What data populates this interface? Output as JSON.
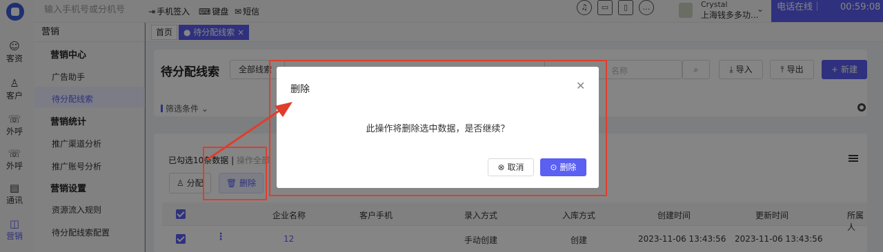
{
  "topbar": {
    "search_placeholder": "输入手机号或分机号",
    "actions": [
      "手机签入",
      "键盘",
      "短信"
    ],
    "user_name": "Crystal",
    "user_org": "上海钱多多功...",
    "phone_status": "电话在线｜",
    "timer": "00:59:08"
  },
  "rail": {
    "items": [
      "客资",
      "客户",
      "外呼",
      "外呼",
      "通讯",
      "营销"
    ]
  },
  "sidebar": {
    "title": "营销",
    "groups": [
      {
        "label": "营销中心",
        "items": [
          "广告助手",
          "待分配线索"
        ]
      },
      {
        "label": "营销统计",
        "items": [
          "推广渠道分析",
          "推广账号分析"
        ]
      },
      {
        "label": "营销设置",
        "items": [
          "资源流入规则",
          "待分配线索配置"
        ]
      }
    ]
  },
  "tabs": [
    "首页",
    "● 待分配线索 ×"
  ],
  "page": {
    "title": "待分配线索",
    "filter_select": "全部线索",
    "search_placeholder": "名称",
    "import_label": "导入",
    "export_label": "导出",
    "new_label": "新建",
    "filter_toggle": "筛选条件"
  },
  "selection": {
    "info": "已勾选10条数据",
    "separator": "|",
    "select_all": "操作全部"
  },
  "actions": {
    "assign": "分配",
    "delete": "删除"
  },
  "table": {
    "headers": [
      "企业名称",
      "客户手机",
      "录入方式",
      "入库方式",
      "创建时间",
      "更新时间",
      "所属人"
    ],
    "rows": [
      [
        "12",
        "",
        "手动创建",
        "创建",
        "2023-11-06 13:43:56",
        "2023-11-06 13:43:56",
        ""
      ]
    ]
  },
  "dialog": {
    "title": "删除",
    "message": "此操作将删除选中数据，是否继续？",
    "cancel_label": "取消",
    "confirm_label": "删除"
  },
  "colors": {
    "accent": "#5b5ff2",
    "annotation": "#e03d2c"
  }
}
